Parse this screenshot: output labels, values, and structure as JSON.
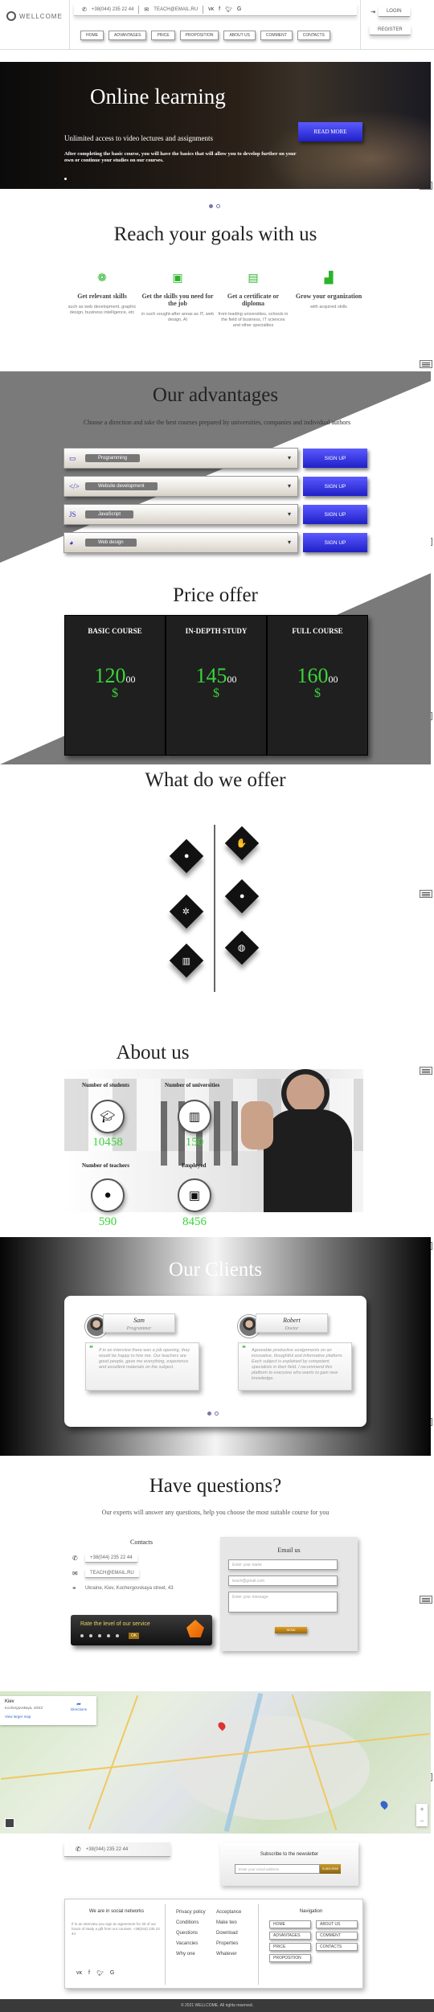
{
  "header": {
    "logo": "WELLCOME",
    "phone": "+38(044) 235 22 44",
    "email": "TEACH@EMAIL.RU",
    "socials": [
      "vk-icon",
      "facebook-icon",
      "twitter-icon",
      "google-icon"
    ],
    "nav": [
      "HOME",
      "ADVANTAGES",
      "PRICE",
      "PROPOSITION",
      "ABOUT US",
      "COMMENT",
      "CONTACTS"
    ],
    "login": "LOGIN",
    "register": "REGISTER"
  },
  "hero": {
    "title": "Online learning",
    "subtitle": "Unlimited access to video lectures and assignments",
    "description": "After completing the basic course, you will have the basics that will allow you to develop further on your own or continue your studies on our courses.",
    "button": "READ MORE"
  },
  "goals": {
    "title": "Reach your goals with us",
    "items": [
      {
        "icon": "brain-icon",
        "title": "Get relevant skills",
        "desc": "such as web development, graphic design, business intelligence, etc"
      },
      {
        "icon": "briefcase-icon",
        "title": "Get the skills you need for the job",
        "desc": "in such sought-after areas as IT, web design, AI"
      },
      {
        "icon": "certificate-icon",
        "title": "Get a certificate or diploma",
        "desc": "from leading universities, schools in the field of business, IT sciences and other specialties"
      },
      {
        "icon": "growth-chart-icon",
        "title": "Grow your organization",
        "desc": "with acquired skills"
      }
    ]
  },
  "advantages": {
    "title": "Our advantages",
    "subtitle": "Choose a direction and take the best courses prepared by universities, companies and individual authors",
    "items": [
      {
        "icon": "laptop-icon",
        "label": "Programming",
        "button": "SIGN UP"
      },
      {
        "icon": "code-icon",
        "label": "Website development",
        "button": "SIGN UP"
      },
      {
        "icon": "js-icon",
        "label": "JavaScript",
        "button": "SIGN UP"
      },
      {
        "icon": "palette-icon",
        "label": "Web design",
        "button": "SIGN UP"
      }
    ]
  },
  "price": {
    "title": "Price offer",
    "cards": [
      {
        "name": "BASIC COURSE",
        "amount": "120",
        "cents": "00",
        "currency": "$"
      },
      {
        "name": "IN-DEPTH STUDY",
        "amount": "145",
        "cents": "00",
        "currency": "$"
      },
      {
        "name": "FULL COURSE",
        "amount": "160",
        "cents": "00",
        "currency": "$"
      }
    ]
  },
  "offer": {
    "title": "What do we offer",
    "left_icons": [
      "user-icon",
      "gears-icon",
      "university-icon"
    ],
    "right_icons": [
      "handshake-icon",
      "graduate-icon",
      "globe-icon"
    ]
  },
  "about": {
    "title": "About us",
    "stats": [
      {
        "label": "Number of students",
        "icon": "graduation-cap-icon",
        "value": "10458"
      },
      {
        "label": "Number of universities",
        "icon": "university-icon",
        "value": "150"
      },
      {
        "label": "Number of teachers",
        "icon": "teacher-icon",
        "value": "590"
      },
      {
        "label": "Employed",
        "icon": "briefcase-icon",
        "value": "8456"
      }
    ]
  },
  "clients": {
    "title": "Our Clients",
    "items": [
      {
        "name": "Sam",
        "role": "Programmer",
        "quote": "If in an interview there was a job opening, they would be happy to hire me. Our teachers are good people, gave me everything, experience and excellent materials on the subject."
      },
      {
        "name": "Robert",
        "role": "Doctor",
        "quote": "Agreeable productive assignments on an innovative, thoughtful and informative platform. Each subject is explained by competent specialists in their field. I recommend this platform to everyone who wants to gain new knowledge."
      }
    ]
  },
  "questions": {
    "title": "Have questions?",
    "subtitle": "Our experts will answer any questions, help you choose the most suitable course for you",
    "contacts_title": "Contacts",
    "phone": "+38(044) 235 22 44",
    "email": "TEACH@EMAIL.RU",
    "address": "Ukraine, Kiev, Kochergovskaya street, 43",
    "rate_text": "Rate the level of our service",
    "rate_button": "OK",
    "email_title": "Email us",
    "name_placeholder": "Enter your name",
    "email_placeholder": "teach@gmail.com",
    "message_placeholder": "Enter your message",
    "send_button": "SEND"
  },
  "map": {
    "place_title": "Kiev",
    "place_sub": "Kochergovskaya, 43/43",
    "directions": "Directions",
    "larger_map": "View larger map"
  },
  "footer": {
    "phone": "+38(044) 235 22 44",
    "subscribe_title": "Subscribe to the newsletter",
    "subscribe_placeholder": "Enter your email address",
    "subscribe_button": "SUBSCRIBE",
    "social_title": "We are in social networks",
    "social_text": "If in an interview you sign an agreement for 30 of our hours of study a gift from our courses. +38(044) 235 22 44",
    "col1": [
      "Privacy policy",
      "Conditions",
      "Questions",
      "Vacancies",
      "Why one"
    ],
    "col2": [
      "Acceptance",
      "Make two",
      "Download",
      "Properties",
      "Whatever"
    ],
    "nav_title": "Navigation",
    "nav": [
      "HOME",
      "ABOUT US",
      "ADVANTAGES",
      "COMMENT",
      "PRICE",
      "CONTACTS",
      "PROPOSITION"
    ],
    "copyright": "© 2021 WELLCOME. All rights reserved."
  }
}
